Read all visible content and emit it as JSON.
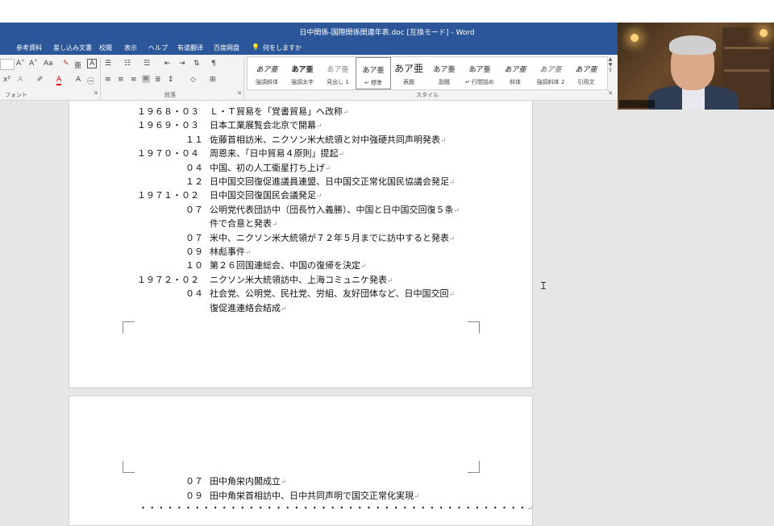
{
  "window": {
    "title": "日中関係-国際関係関連年表.doc [互換モード] - Word"
  },
  "menu": {
    "items": [
      "参考資料",
      "差し込み文書",
      "校閲",
      "表示",
      "ヘルプ",
      "有道翻译",
      "百度网盘"
    ],
    "tell_me": "何をしますか"
  },
  "ribbon": {
    "font_group_label": "フォント",
    "paragraph_group_label": "段落",
    "styles_group_label": "スタイル",
    "styles": [
      {
        "sample": "あア亜",
        "name": "強調斜体"
      },
      {
        "sample": "あア亜",
        "name": "強調太字"
      },
      {
        "sample": "あア亜",
        "name": "見出し 1"
      },
      {
        "sample": "あア亜",
        "name": "↵ 標準"
      },
      {
        "sample": "あア亜",
        "name": "表題"
      },
      {
        "sample": "あア亜",
        "name": "副題"
      },
      {
        "sample": "あア亜",
        "name": "↵ 行間詰め"
      },
      {
        "sample": "あア亜",
        "name": "斜体"
      },
      {
        "sample": "あア亜",
        "name": "強調斜体 2"
      },
      {
        "sample": "あア亜",
        "name": "引用文"
      }
    ]
  },
  "document": {
    "page1_lines": [
      {
        "date": "１９６８・０３",
        "text": "Ｌ・Ｔ貿易を「覚書貿易」へ改称"
      },
      {
        "date": "１９６９・０３",
        "text": "日本工業展覧会北京で開幕"
      },
      {
        "date": "１１",
        "text": "佐藤首相訪米、ニクソン米大統領と対中強硬共同声明発表"
      },
      {
        "date": "１９７０・０４",
        "text": "周恩来、「日中貿易４原則」提起"
      },
      {
        "date": "０４",
        "text": "中国、初の人工衛星打ち上げ"
      },
      {
        "date": "１２",
        "text": "日中国交回復促進議員連盟、日中国交正常化国民協議会発足"
      },
      {
        "date": "１９７１・０２",
        "text": "日中国交回復国民会議発足"
      },
      {
        "date": "０７",
        "text": "公明党代表団訪中（団長竹入義勝）、中国と日中国交回復５条"
      },
      {
        "date": "",
        "text": "件で合意と発表"
      },
      {
        "date": "０７",
        "text": "米中、ニクソン米大統領が７２年５月までに訪中すると発表"
      },
      {
        "date": "０９",
        "text": "林彪事件"
      },
      {
        "date": "１０",
        "text": "第２６回国連総会、中国の復帰を決定"
      },
      {
        "date": "１９７２・０２",
        "text": "ニクソン米大統領訪中、上海コミュニケ発表"
      },
      {
        "date": "０４",
        "text": "社会党、公明党、民社党、労組、友好団体など、日中国交回"
      },
      {
        "date": "",
        "text": "復促進連絡会結成"
      }
    ],
    "page2_lines": [
      {
        "date": "０７",
        "text": "田中角栄内閣成立"
      },
      {
        "date": "０９",
        "text": "田中角栄首相訪中、日中共同声明で国交正常化実現"
      }
    ],
    "dotted_line": "・・・・・・・・・・・・・・・・・・・・・・・・・・・・・・・・・・・・・・・・・・・",
    "para_mark": "↵",
    "cursor_icon": "i-beam-cursor"
  },
  "colors": {
    "title_bar": "#2b579a",
    "canvas": "#e6e6e6"
  }
}
